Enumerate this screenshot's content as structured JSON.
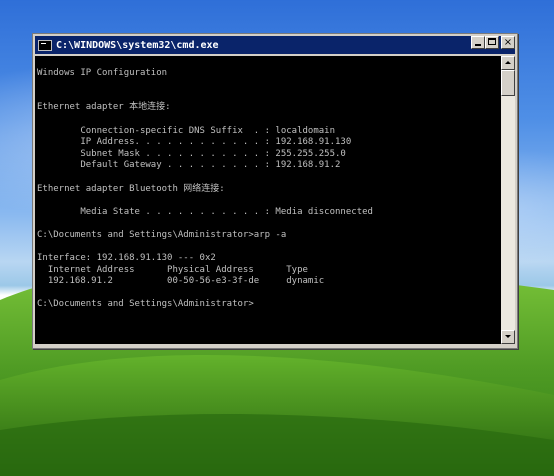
{
  "window": {
    "title": "C:\\WINDOWS\\system32\\cmd.exe",
    "icon": "cmd-icon",
    "buttons": {
      "minimize": "minimize-icon",
      "maximize": "maximize-icon",
      "close": "×"
    }
  },
  "console": {
    "lines": [
      "",
      "Windows IP Configuration",
      "",
      "",
      "Ethernet adapter 本地连接:",
      "",
      "        Connection-specific DNS Suffix  . : localdomain",
      "        IP Address. . . . . . . . . . . . : 192.168.91.130",
      "        Subnet Mask . . . . . . . . . . . : 255.255.255.0",
      "        Default Gateway . . . . . . . . . : 192.168.91.2",
      "",
      "Ethernet adapter Bluetooth 网络连接:",
      "",
      "        Media State . . . . . . . . . . . : Media disconnected",
      "",
      "C:\\Documents and Settings\\Administrator>arp -a",
      "",
      "Interface: 192.168.91.130 --- 0x2",
      "  Internet Address      Physical Address      Type",
      "  192.168.91.2          00-50-56-e3-3f-de     dynamic",
      "",
      "C:\\Documents and Settings\\Administrator>",
      "",
      "",
      ""
    ]
  },
  "colors": {
    "titlebar": "#0a246a",
    "console_bg": "#000000",
    "console_text": "#c0c0c0"
  }
}
